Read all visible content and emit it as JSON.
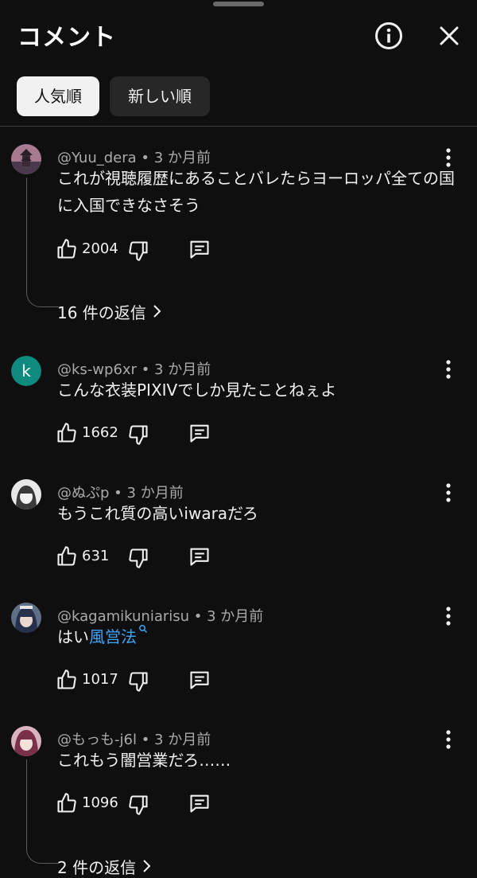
{
  "header": {
    "title": "コメント"
  },
  "sort": {
    "top_label": "人気順",
    "newest_label": "新しい順"
  },
  "comments": [
    {
      "author": "@Yuu_dera",
      "time": "3 か月前",
      "text": "これが視聴履歴にあることバレたらヨーロッパ全ての国に入国できなさそう",
      "likes": "2004",
      "replies": "16 件の返信"
    },
    {
      "author": "@ks-wp6xr",
      "time": "3 か月前",
      "text": "こんな衣装PIXIVでしか見たことねぇよ",
      "likes": "1662",
      "avatar_letter": "k",
      "avatar_color": "#0f8a7e"
    },
    {
      "author": "@ぬぷp",
      "time": "3 か月前",
      "text": "もうこれ質の高いiwaraだろ",
      "likes": "631"
    },
    {
      "author": "@kagamikuniarisu",
      "time": "3 か月前",
      "text_prefix": "はい",
      "text_link": "風営法",
      "likes": "1017"
    },
    {
      "author": "@もっも-j6l",
      "time": "3 か月前",
      "text": "これもう闇営業だろ……",
      "likes": "1096",
      "replies": "2 件の返信"
    }
  ],
  "colors": {
    "background": "#0f0f0f",
    "link": "#3ea6ff",
    "meta": "#aaaaaa"
  }
}
